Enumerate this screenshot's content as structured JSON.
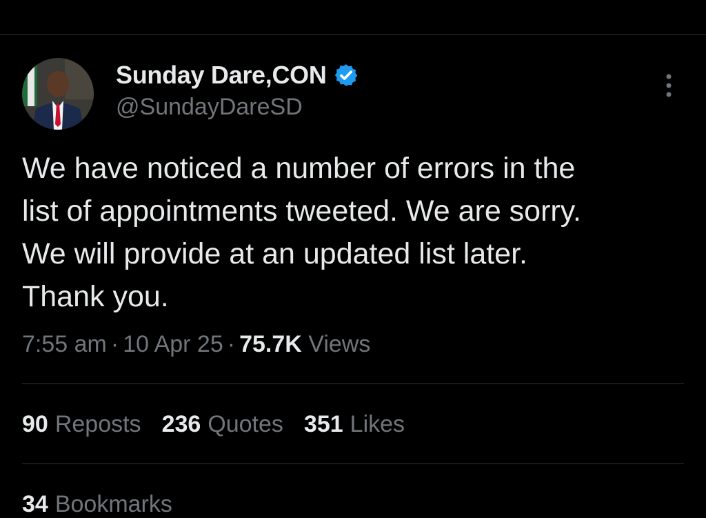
{
  "author": {
    "display_name": "Sunday Dare,CON",
    "handle": "@SundayDareSD",
    "verified_icon": "verified-badge-icon",
    "avatar_icon": "avatar"
  },
  "tweet": {
    "text_lines": [
      "We have noticed a number of errors in the",
      "list of appointments tweeted. We are sorry.",
      "We will provide at an updated list later.",
      "Thank you."
    ],
    "time": "7:55 am",
    "date": "10 Apr 25",
    "views_count": "75.7K",
    "views_label": "Views"
  },
  "stats": {
    "reposts_count": "90",
    "reposts_label": "Reposts",
    "quotes_count": "236",
    "quotes_label": "Quotes",
    "likes_count": "351",
    "likes_label": "Likes",
    "bookmarks_count": "34",
    "bookmarks_label": "Bookmarks"
  },
  "colors": {
    "background": "#000000",
    "text_primary": "#e7e9ea",
    "text_secondary": "#71767b",
    "divider": "#2f3336",
    "verified_blue": "#1d9bf0"
  }
}
